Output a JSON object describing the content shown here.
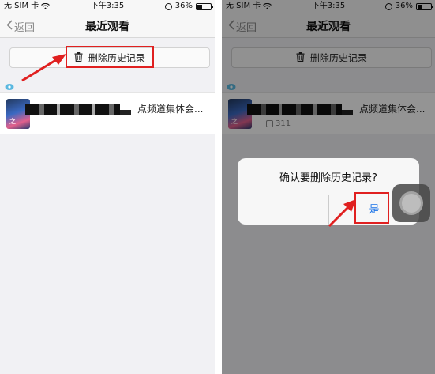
{
  "status_bar": {
    "carrier": "无 SIM 卡",
    "time": "下午3:35",
    "battery": "36%",
    "battery_level": 0.36
  },
  "nav": {
    "back_label": "返回",
    "title": "最近观看"
  },
  "toolbar": {
    "clear_history_label": "删除历史记录"
  },
  "history": {
    "items": [
      {
        "title_suffix": "点频道集体会...",
        "play_count": "311"
      }
    ]
  },
  "dialog": {
    "message": "确认要删除历史记录?",
    "confirm_label": "是"
  },
  "colors": {
    "annotation_red": "#e02020",
    "link_blue": "#1a73e8"
  }
}
